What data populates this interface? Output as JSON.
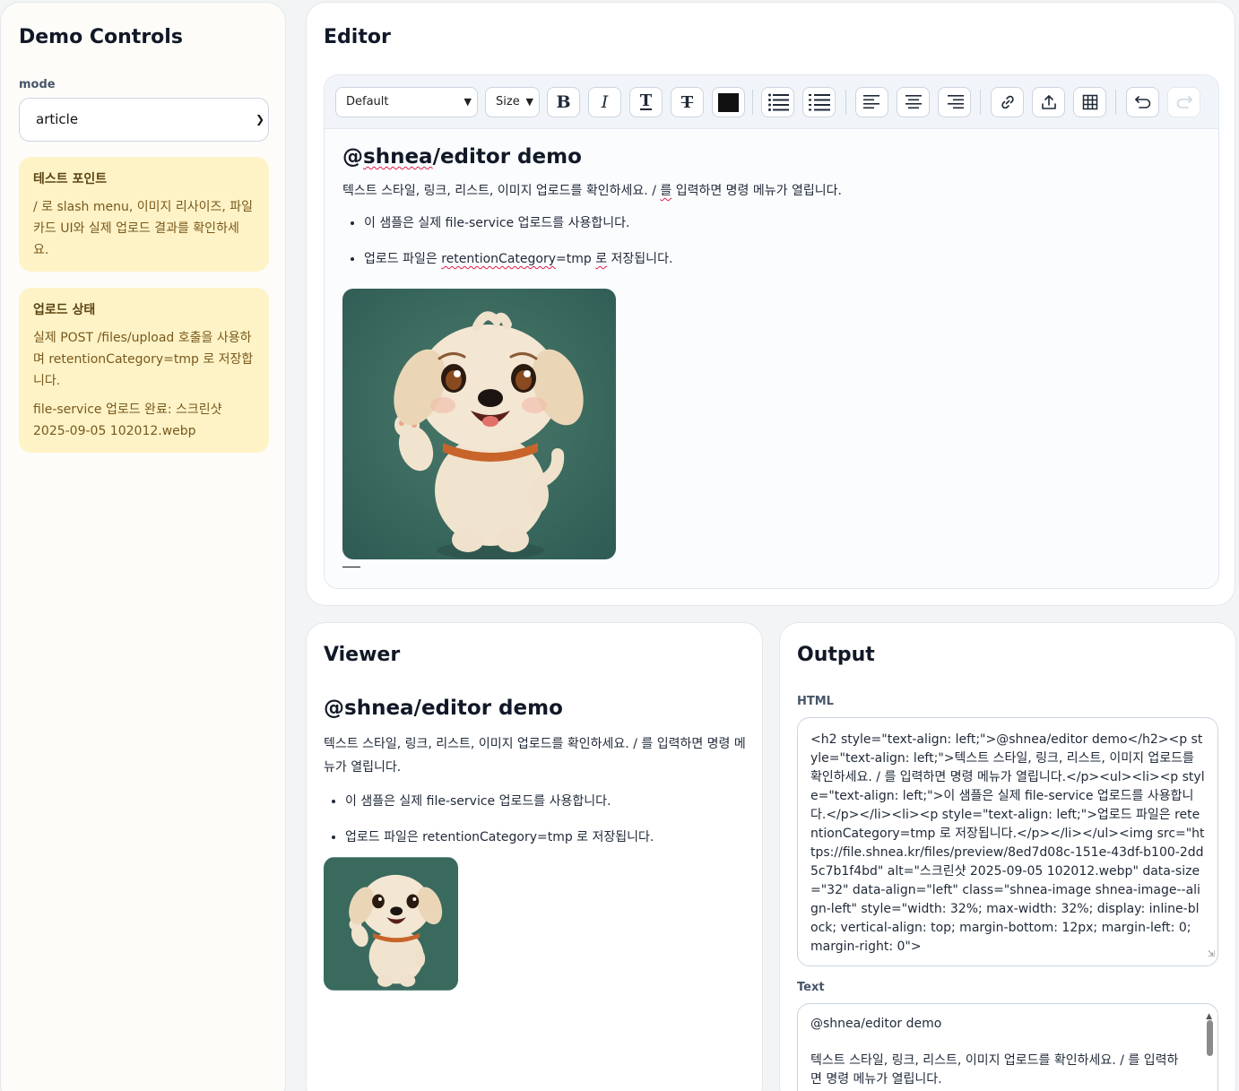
{
  "sidebar": {
    "title": "Demo Controls",
    "mode_label": "mode",
    "mode_value": "article",
    "notes": [
      {
        "title": "테스트 포인트",
        "paragraphs": [
          "/ 로 slash menu, 이미지 리사이즈, 파일 카드 UI와 실제 업로드 결과를 확인하세요."
        ]
      },
      {
        "title": "업로드 상태",
        "paragraphs": [
          "실제 POST /files/upload 호출을 사용하며 retentionCategory=tmp 로 저장합니다.",
          "file-service 업로드 완료: 스크린샷 2025-09-05 102012.webp"
        ]
      }
    ]
  },
  "editor": {
    "title": "Editor",
    "toolbar": {
      "font_select": "Default",
      "size_select": "Size",
      "buttons": [
        {
          "name": "bold-button",
          "icon": "bold-icon",
          "glyph": "B"
        },
        {
          "name": "italic-button",
          "icon": "italic-icon",
          "glyph": "I"
        },
        {
          "name": "text-style-button",
          "icon": "text-icon",
          "glyph": "T"
        },
        {
          "name": "strike-text-button",
          "icon": "strikethrough-icon",
          "glyph": "Ŧ"
        },
        {
          "name": "text-color-button",
          "icon": "color-swatch-icon",
          "glyph": ""
        },
        {
          "name": "bullet-list-button",
          "icon": "bullet-list-icon",
          "glyph": "☰"
        },
        {
          "name": "ordered-list-button",
          "icon": "ordered-list-icon",
          "glyph": "☷"
        },
        {
          "name": "align-left-button",
          "icon": "align-left-icon",
          "glyph": "≡"
        },
        {
          "name": "align-center-button",
          "icon": "align-center-icon",
          "glyph": "≡"
        },
        {
          "name": "align-right-button",
          "icon": "align-right-icon",
          "glyph": "≡"
        },
        {
          "name": "link-button",
          "icon": "link-icon",
          "glyph": "🔗"
        },
        {
          "name": "upload-button",
          "icon": "upload-icon",
          "glyph": "⇪"
        },
        {
          "name": "table-button",
          "icon": "table-icon",
          "glyph": "▦"
        },
        {
          "name": "undo-button",
          "icon": "undo-icon",
          "glyph": "↶"
        },
        {
          "name": "redo-button",
          "icon": "redo-icon",
          "glyph": "↷"
        }
      ]
    },
    "doc": {
      "title_prefix": "@",
      "title_word": "shnea",
      "title_suffix": "/editor demo",
      "para_before": "텍스트 스타일, 링크, 리스트, 이미지 업로드를 확인하세요. / ",
      "para_word": "를",
      "para_after": " 입력하면 명령 메뉴가 열립니다.",
      "li1": "이 샘플은 실제 file-service 업로드를 사용합니다.",
      "li2_before": "업로드 파일은 ",
      "li2_word1": "retentionCategory",
      "li2_mid": "=tmp ",
      "li2_word2": "로",
      "li2_after": " 저장됩니다."
    }
  },
  "viewer": {
    "title": "Viewer",
    "doc_title": "@shnea/editor demo",
    "para": "텍스트 스타일, 링크, 리스트, 이미지 업로드를 확인하세요. / 를 입력하면 명령 메뉴가 열립니다.",
    "li1": "이 샘플은 실제 file-service 업로드를 사용합니다.",
    "li2": "업로드 파일은 retentionCategory=tmp 로 저장됩니다."
  },
  "output": {
    "title": "Output",
    "html_label": "HTML",
    "html_value": "<h2 style=\"text-align: left;\">@shnea/editor demo</h2><p style=\"text-align: left;\">텍스트 스타일, 링크, 리스트, 이미지 업로드를 확인하세요. / 를 입력하면 명령 메뉴가 열립니다.</p><ul><li><p style=\"text-align: left;\">이 샘플은 실제 file-service 업로드를 사용합니다.</p></li><li><p style=\"text-align: left;\">업로드 파일은 retentionCategory=tmp 로 저장됩니다.</p></li></ul><img src=\"https://file.shnea.kr/files/preview/8ed7d08c-151e-43df-b100-2dd5c7b1f4bd\" alt=\"스크린샷 2025-09-05 102012.webp\" data-size=\"32\" data-align=\"left\" class=\"shnea-image shnea-image--align-left\" style=\"width: 32%; max-width: 32%; display: inline-block; vertical-align: top; margin-bottom: 12px; margin-left: 0; margin-right: 0\">",
    "text_label": "Text",
    "text_line1": "@shnea/editor demo",
    "text_line2": "텍스트 스타일, 링크, 리스트, 이미지 업로드를 확인하세요. / 를 입력하면 명령 메뉴가 열립니다."
  },
  "colors": {
    "note_bg": "#fef3c7",
    "text_color_swatch": "#111111",
    "dog_bg": "#3f6b5f"
  }
}
